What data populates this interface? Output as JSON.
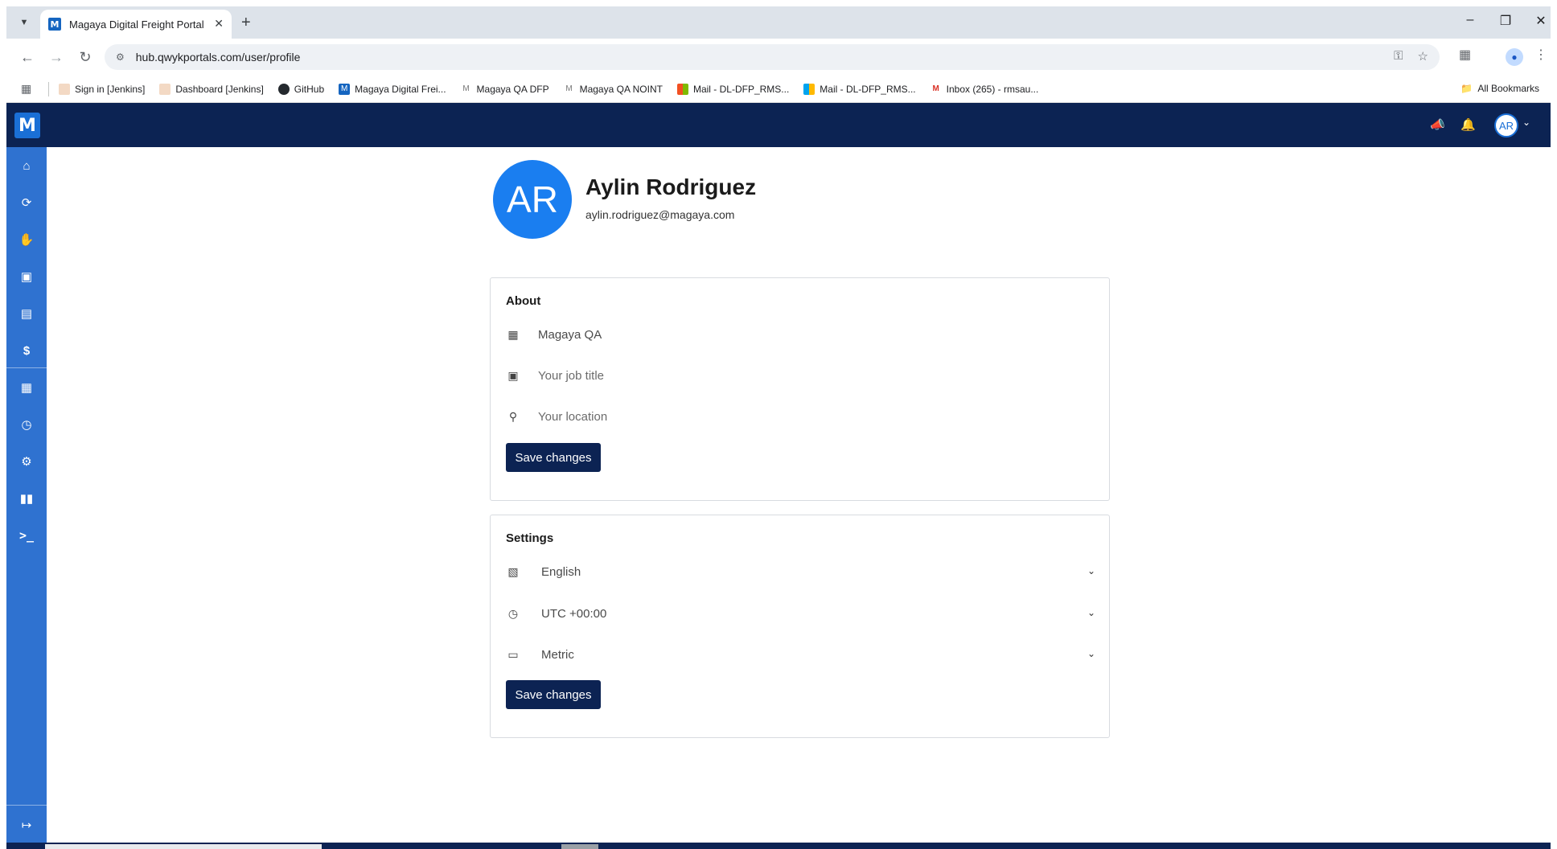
{
  "browser": {
    "tab_title": "Magaya Digital Freight Portal H",
    "url": "hub.qwykportals.com/user/profile",
    "bookmarks": [
      {
        "label": "Sign in [Jenkins]"
      },
      {
        "label": "Dashboard [Jenkins]"
      },
      {
        "label": "GitHub"
      },
      {
        "label": "Magaya Digital Frei..."
      },
      {
        "label": "Magaya QA DFP"
      },
      {
        "label": "Magaya QA NOINT"
      },
      {
        "label": "Mail - DL-DFP_RMS..."
      },
      {
        "label": "Mail - DL-DFP_RMS..."
      },
      {
        "label": "Inbox (265) - rmsau..."
      }
    ],
    "all_bookmarks": "All Bookmarks"
  },
  "app": {
    "logo_letter": "M",
    "header_avatar": "AR",
    "sidebar_icons": [
      "home-icon",
      "shipments-icon",
      "quotes-icon",
      "bookings-icon",
      "documents-icon",
      "billing-icon",
      "warehouse-icon",
      "history-icon",
      "settings-icon",
      "library-icon",
      "terminal-icon",
      "logout-icon"
    ]
  },
  "profile": {
    "initials": "AR",
    "name": "Aylin Rodriguez",
    "email": "aylin.rodriguez@magaya.com"
  },
  "about": {
    "title": "About",
    "company": "Magaya QA",
    "job_title_placeholder": "Your job title",
    "location_placeholder": "Your location",
    "save_label": "Save changes"
  },
  "settings": {
    "title": "Settings",
    "language": "English",
    "timezone": "UTC +00:00",
    "units": "Metric",
    "save_label": "Save changes"
  },
  "colors": {
    "header": "#0c2353",
    "sidebar": "#2f72d0",
    "avatar": "#1a7ef0",
    "button": "#0c2353"
  }
}
